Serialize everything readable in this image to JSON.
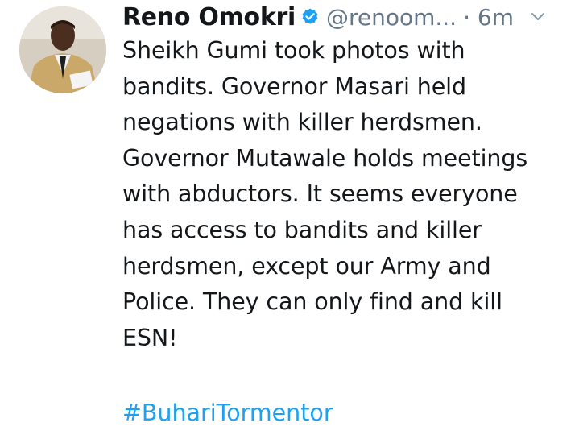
{
  "tweet": {
    "author": {
      "display_name": "Reno Omokri",
      "handle": "@renoom...",
      "verified_icon": "verified-badge-icon"
    },
    "timestamp": "· 6m",
    "menu_icon": "chevron-down-icon",
    "text_lines": [
      "Sheikh Gumi took photos with",
      "bandits. Governor Masari held",
      "negations with killer herdsmen.",
      "Governor Mutawale holds meetings",
      "with abductors. It seems everyone",
      "has access to bandits and killer",
      "herdsmen, except our Army and",
      "Police. They can only find and kill",
      "ESN!"
    ],
    "hashtag": "#BuhariTormentor"
  },
  "colors": {
    "text": "#14171a",
    "secondary": "#657786",
    "link": "#1da1f2",
    "verified": "#1da1f2"
  }
}
